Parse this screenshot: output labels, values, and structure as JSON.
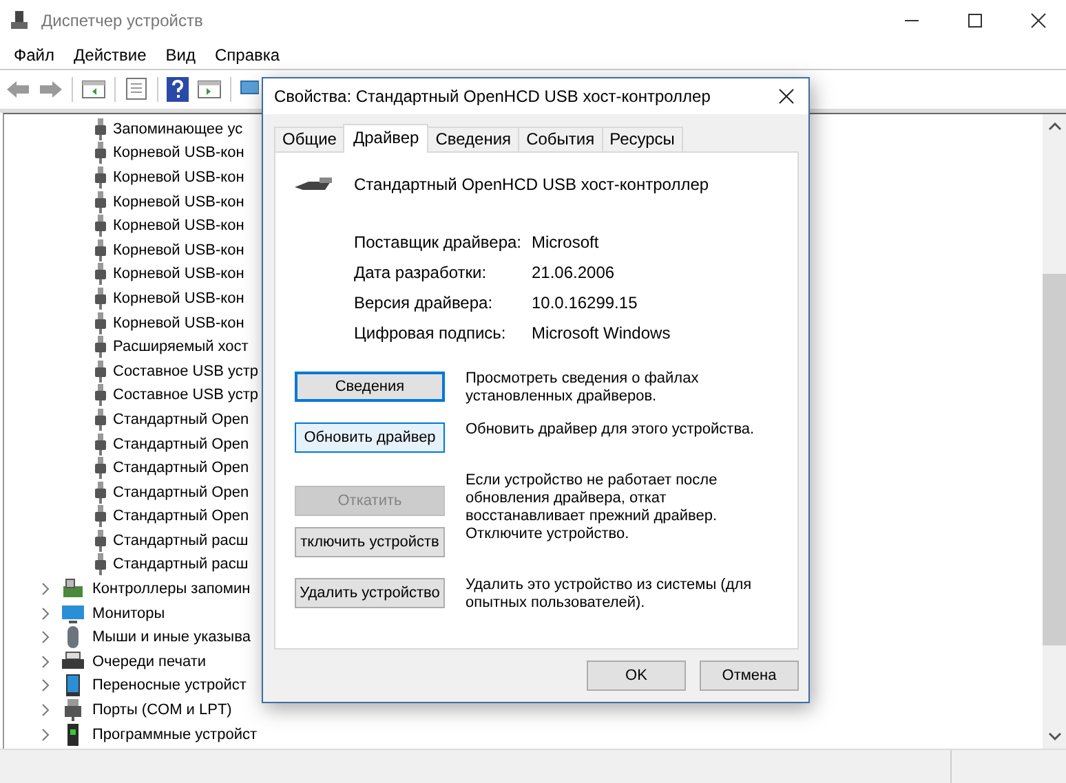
{
  "window": {
    "title": "Диспетчер устройств"
  },
  "menu": [
    "Файл",
    "Действие",
    "Вид",
    "Справка"
  ],
  "tree": {
    "items": [
      {
        "kind": "usb-device",
        "label": "Запоминающее ус"
      },
      {
        "kind": "usb-device",
        "label": "Корневой USB-кон"
      },
      {
        "kind": "usb-device",
        "label": "Корневой USB-кон"
      },
      {
        "kind": "usb-device",
        "label": "Корневой USB-кон"
      },
      {
        "kind": "usb-device",
        "label": "Корневой USB-кон"
      },
      {
        "kind": "usb-device",
        "label": "Корневой USB-кон"
      },
      {
        "kind": "usb-device",
        "label": "Корневой USB-кон"
      },
      {
        "kind": "usb-device",
        "label": "Корневой USB-кон"
      },
      {
        "kind": "usb-device",
        "label": "Корневой USB-кон"
      },
      {
        "kind": "usb-device",
        "label": "Расширяемый хост"
      },
      {
        "kind": "usb-device",
        "label": "Составное USB устр"
      },
      {
        "kind": "usb-device",
        "label": "Составное USB устр"
      },
      {
        "kind": "usb-device",
        "label": "Стандартный Open"
      },
      {
        "kind": "usb-device",
        "label": "Стандартный Open"
      },
      {
        "kind": "usb-device",
        "label": "Стандартный Open"
      },
      {
        "kind": "usb-device",
        "label": "Стандартный Open"
      },
      {
        "kind": "usb-device",
        "label": "Стандартный Open"
      },
      {
        "kind": "usb-device",
        "label": "Стандартный расш"
      },
      {
        "kind": "usb-device",
        "label": "Стандартный расш"
      },
      {
        "kind": "storage",
        "label": "Контроллеры запомин",
        "expanded": false
      },
      {
        "kind": "monitor",
        "label": "Мониторы",
        "expanded": false
      },
      {
        "kind": "mouse",
        "label": "Мыши и иные указыва",
        "expanded": false
      },
      {
        "kind": "printer",
        "label": "Очереди печати",
        "expanded": false
      },
      {
        "kind": "portable",
        "label": "Переносные устройст",
        "expanded": false
      },
      {
        "kind": "port",
        "label": "Порты (COM и LPT)",
        "expanded": false
      },
      {
        "kind": "software",
        "label": "Программные устройст",
        "expanded": false
      }
    ]
  },
  "dialog": {
    "title": "Свойства: Стандартный OpenHCD USB хост-контроллер",
    "tabs": [
      {
        "label": "Общие",
        "selected": false
      },
      {
        "label": "Драйвер",
        "selected": true
      },
      {
        "label": "Сведения",
        "selected": false
      },
      {
        "label": "События",
        "selected": false
      },
      {
        "label": "Ресурсы",
        "selected": false
      }
    ],
    "device_name": "Стандартный OpenHCD USB хост-контроллер",
    "properties": [
      {
        "label": "Поставщик драйвера:",
        "value": "Microsoft"
      },
      {
        "label": "Дата разработки:",
        "value": "21.06.2006"
      },
      {
        "label": "Версия драйвера:",
        "value": "10.0.16299.15"
      },
      {
        "label": "Цифровая подпись:",
        "value": "Microsoft Windows"
      }
    ],
    "actions": [
      {
        "button": "Сведения",
        "description": "Просмотреть сведения о файлах установленных драйверов.",
        "disabled": false,
        "focused": true,
        "hovered": false
      },
      {
        "button": "Обновить драйвер",
        "description": "Обновить драйвер для этого устройства.",
        "disabled": false,
        "focused": false,
        "hovered": true
      },
      {
        "button": "Откатить",
        "description": "Если устройство не работает после обновления драйвера, откат восстанавливает прежний драйвер.",
        "disabled": true,
        "focused": false,
        "hovered": false
      },
      {
        "button": "тключить устройств",
        "description": "Отключите устройство.",
        "disabled": false,
        "focused": false,
        "hovered": false
      },
      {
        "button": "Удалить устройство",
        "description": "Удалить это устройство из системы (для опытных пользователей).",
        "disabled": false,
        "focused": false,
        "hovered": false
      }
    ],
    "buttons": [
      "OK",
      "Отмена"
    ]
  }
}
